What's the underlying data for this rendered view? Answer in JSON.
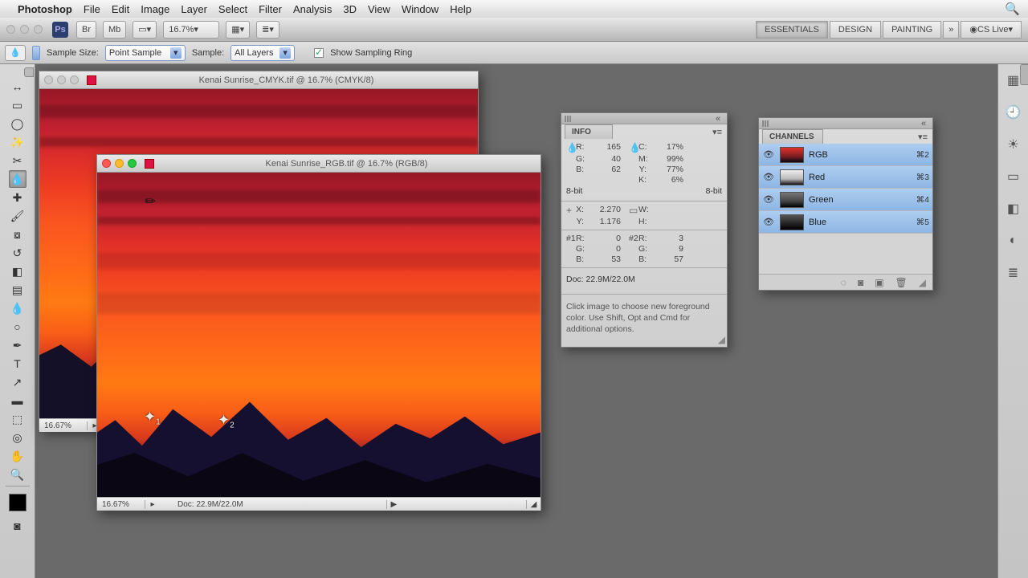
{
  "mac_menu": {
    "app": "Photoshop",
    "items": [
      "File",
      "Edit",
      "Image",
      "Layer",
      "Select",
      "Filter",
      "Analysis",
      "3D",
      "View",
      "Window",
      "Help"
    ]
  },
  "zoom_display": "16.7%",
  "workspaces": {
    "essentials": "ESSENTIALS",
    "design": "DESIGN",
    "painting": "PAINTING",
    "cslive": "CS Live"
  },
  "options": {
    "sample_size_label": "Sample Size:",
    "sample_size_value": "Point Sample",
    "sample_label": "Sample:",
    "sample_value": "All Layers",
    "show_ring": "Show Sampling Ring"
  },
  "doc_cmyk": {
    "title": "Kenai Sunrise_CMYK.tif @ 16.7% (CMYK/8)",
    "zoom": "16.67%"
  },
  "doc_rgb": {
    "title": "Kenai Sunrise_RGB.tif @ 16.7% (RGB/8)",
    "zoom": "16.67%",
    "docsize": "Doc: 22.9M/22.0M"
  },
  "info_panel": {
    "title": "INFO",
    "rgb": {
      "R": "165",
      "G": "40",
      "B": "62"
    },
    "cmyk": {
      "C": "17%",
      "M": "99%",
      "Y": "77%",
      "K": "6%"
    },
    "bit1": "8-bit",
    "bit2": "8-bit",
    "xy": {
      "X": "2.270",
      "Y": "1.176"
    },
    "wh": {
      "W": "",
      "H": ""
    },
    "s1": {
      "label": "#1",
      "R": "0",
      "G": "0",
      "B": "53"
    },
    "s2": {
      "label": "#2",
      "R": "3",
      "G": "9",
      "B": "57"
    },
    "docline": "Doc: 22.9M/22.0M",
    "hint": "Click image to choose new foreground color. Use Shift, Opt and Cmd for additional options."
  },
  "channels_panel": {
    "title": "CHANNELS",
    "rows": [
      {
        "name": "RGB",
        "short": "⌘2",
        "thumb": "linear-gradient(#e03029,#7b1f24 60%,#0a0712)"
      },
      {
        "name": "Red",
        "short": "⌘3",
        "thumb": "linear-gradient(#eee,#bbb 60%,#111)"
      },
      {
        "name": "Green",
        "short": "⌘4",
        "thumb": "linear-gradient(#777,#444 60%,#000)"
      },
      {
        "name": "Blue",
        "short": "⌘5",
        "thumb": "linear-gradient(#555,#222 60%,#000)"
      }
    ]
  }
}
